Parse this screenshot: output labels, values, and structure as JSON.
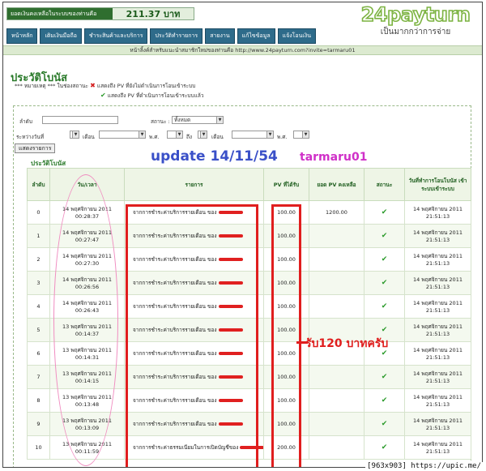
{
  "header": {
    "balance_label": "ยอดเงินคงเหลือในระบบของท่านคือ",
    "balance_value": "211.37 บาท",
    "logo_text": "24payturn",
    "logo_tagline": "เป็นมากกว่าการจ่าย"
  },
  "nav": {
    "items": [
      {
        "label": "หน้าหลัก"
      },
      {
        "label": "เติมเงินมือถือ"
      },
      {
        "label": "ชำระสินค้าและบริการ"
      },
      {
        "label": "ประวัติทำรายการ"
      },
      {
        "label": "สายงาน"
      },
      {
        "label": "แก้ไขข้อมูล"
      },
      {
        "label": "แจ้งโอนเงิน"
      }
    ]
  },
  "invite_text": "หน้าลิ้งค์สำหรับแนะนำสมาชิกใหม่ของท่านคือ http://www.24payturn.com?invite=tarmaru01",
  "page": {
    "title": "ประวัติโบนัส",
    "note_prefix": "*** หมายเหตุ *** ในช่องสถานะ",
    "note_pending": "แสดงถึง PV ที่ยังไม่ดำเนินการโอนเข้าระบบ",
    "note_done": "แสดงถึง PV ที่ดำเนินการโอนเข้าระบบแล้ว"
  },
  "filters": {
    "order_label": "ลำดับ",
    "status_label": "สถานะ :",
    "status_value": "ทั้งหมด",
    "date_range_label": "ระหว่างวันที่",
    "month_label": "เดือน",
    "year_label": "พ.ศ.",
    "to_label": "ถึง",
    "show_button": "แสดงรายการ"
  },
  "section_title": "ประวัติโบนัส",
  "annotations": {
    "update": "update 14/11/54",
    "user": "tarmaru01",
    "bonus": "รับ120 บาทครับ"
  },
  "table": {
    "headers": [
      "ลำดับ",
      "วัน/เวลา",
      "รายการ",
      "PV ที่ได้รับ",
      "ยอด PV คงเหลือ",
      "สถานะ",
      "วันที่ทำการโอนโบนัส เข้าระบบเข้าระบบ"
    ],
    "rows": [
      {
        "no": "0",
        "date": "14 พฤศจิกายน 2011",
        "time": "00:28:37",
        "desc": "จากการชำระค่าบริการรายเดือน ของ",
        "pv": "100.00",
        "balance": "1200.00",
        "transfer_date": "14 พฤศจิกายน 2011",
        "transfer_time": "21:51:13"
      },
      {
        "no": "1",
        "date": "14 พฤศจิกายน 2011",
        "time": "00:27:47",
        "desc": "จากการชำระค่าบริการรายเดือน ของ",
        "pv": "100.00",
        "balance": "",
        "transfer_date": "14 พฤศจิกายน 2011",
        "transfer_time": "21:51:13"
      },
      {
        "no": "2",
        "date": "14 พฤศจิกายน 2011",
        "time": "00:27:30",
        "desc": "จากการชำระค่าบริการรายเดือน ของ",
        "pv": "100.00",
        "balance": "",
        "transfer_date": "14 พฤศจิกายน 2011",
        "transfer_time": "21:51:13"
      },
      {
        "no": "3",
        "date": "14 พฤศจิกายน 2011",
        "time": "00:26:56",
        "desc": "จากการชำระค่าบริการรายเดือน ของ",
        "pv": "100.00",
        "balance": "",
        "transfer_date": "14 พฤศจิกายน 2011",
        "transfer_time": "21:51:13"
      },
      {
        "no": "4",
        "date": "14 พฤศจิกายน 2011",
        "time": "00:26:43",
        "desc": "จากการชำระค่าบริการรายเดือน ของ",
        "pv": "100.00",
        "balance": "",
        "transfer_date": "14 พฤศจิกายน 2011",
        "transfer_time": "21:51:13"
      },
      {
        "no": "5",
        "date": "13 พฤศจิกายน 2011",
        "time": "00:14:37",
        "desc": "จากการชำระค่าบริการรายเดือน ของ",
        "pv": "100.00",
        "balance": "",
        "transfer_date": "14 พฤศจิกายน 2011",
        "transfer_time": "21:51:13"
      },
      {
        "no": "6",
        "date": "13 พฤศจิกายน 2011",
        "time": "00:14:31",
        "desc": "จากการชำระค่าบริการรายเดือน ของ",
        "pv": "100.00",
        "balance": "",
        "transfer_date": "14 พฤศจิกายน 2011",
        "transfer_time": "21:51:13"
      },
      {
        "no": "7",
        "date": "13 พฤศจิกายน 2011",
        "time": "00:14:15",
        "desc": "จากการชำระค่าบริการรายเดือน ของ",
        "pv": "100.00",
        "balance": "",
        "transfer_date": "14 พฤศจิกายน 2011",
        "transfer_time": "21:51:13"
      },
      {
        "no": "8",
        "date": "13 พฤศจิกายน 2011",
        "time": "00:13:48",
        "desc": "จากการชำระค่าบริการรายเดือน ของ",
        "pv": "100.00",
        "balance": "",
        "transfer_date": "14 พฤศจิกายน 2011",
        "transfer_time": "21:51:13"
      },
      {
        "no": "9",
        "date": "13 พฤศจิกายน 2011",
        "time": "00:13:09",
        "desc": "จากการชำระค่าบริการรายเดือน ของ",
        "pv": "100.00",
        "balance": "",
        "transfer_date": "14 พฤศจิกายน 2011",
        "transfer_time": "21:51:13"
      },
      {
        "no": "10",
        "date": "13 พฤศจิกายน 2011",
        "time": "00:11:59",
        "desc": "จากการชำระค่าธรรมเนียมในการเปิดบัญชีของ",
        "pv": "200.00",
        "balance": "",
        "transfer_date": "14 พฤศจิกายน 2011",
        "transfer_time": "21:51:13"
      }
    ]
  },
  "watermark": "[963x903] https://upic.me/",
  "colors": {
    "brand_green": "#2a7a2a",
    "nav_blue": "#2e6b8a",
    "annotation_red": "#e01e1e",
    "annotation_blue": "#3a50c8",
    "annotation_magenta": "#d030c8",
    "annotation_pink": "#f08cc0"
  }
}
